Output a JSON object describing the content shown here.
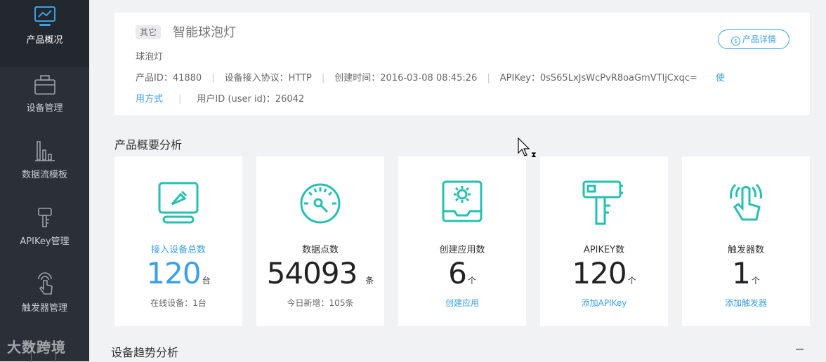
{
  "sidebar": {
    "items": [
      {
        "label": "产品概况",
        "icon": "monitor-chart-icon",
        "active": true
      },
      {
        "label": "设备管理",
        "icon": "toolbox-icon",
        "active": false
      },
      {
        "label": "数据流模板",
        "icon": "bar-chart-icon",
        "active": false
      },
      {
        "label": "APIKey管理",
        "icon": "key-icon",
        "active": false
      },
      {
        "label": "触发器管理",
        "icon": "hand-touch-icon",
        "active": false
      }
    ]
  },
  "product": {
    "tag": "其它",
    "name": "智能球泡灯",
    "description": "球泡灯",
    "detail_button": "产品详情",
    "id_text": "产品ID：41880",
    "protocol_text": "设备接入协议：HTTP",
    "created_text": "创建时间：2016-03-08 08:45:26",
    "apikey_text": "APIKey：0sS65LxJsWcPvR8oaGmVTljCxqc=",
    "usage_link_part1": "使",
    "usage_link_part2": "用方式",
    "user_id_text": "用户ID (user id)：26042"
  },
  "overview": {
    "title": "产品概要分析",
    "cards": [
      {
        "label": "接入设备总数",
        "value": "120",
        "unit": "台",
        "foot": "在线设备：1台",
        "icon": "device-screen-icon"
      },
      {
        "label": "数据点数",
        "value": "54093",
        "unit": "条",
        "foot": "今日新增：105条",
        "icon": "gauge-icon"
      },
      {
        "label": "创建应用数",
        "value": "6",
        "unit": "个",
        "foot": "创建应用",
        "icon": "app-gear-icon"
      },
      {
        "label": "APIKEY数",
        "value": "120",
        "unit": "个",
        "foot": "添加APIKey",
        "icon": "key-icon"
      },
      {
        "label": "触发器数",
        "value": "1",
        "unit": "个",
        "foot": "添加触发器",
        "icon": "hand-touch-icon"
      }
    ]
  },
  "trend": {
    "title": "设备趋势分析"
  },
  "watermark": "大数跨境",
  "colors": {
    "accent": "#3aa0e6",
    "icon_teal": "#26c0b0",
    "sidebar": "#2b3038"
  }
}
